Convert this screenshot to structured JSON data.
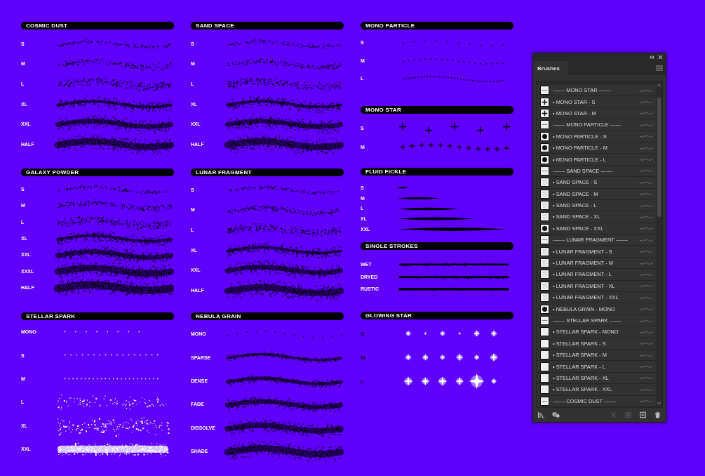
{
  "columns": [
    [
      {
        "title": "COSMIC DUST",
        "kind": "dust",
        "rows": [
          "S",
          "M",
          "L",
          "XL",
          "XXL",
          "HALF"
        ]
      },
      {
        "title": "GALAXY POWDER",
        "kind": "dust",
        "rows": [
          "S",
          "M",
          "L",
          "XL",
          "XXL",
          "XXXL",
          "HALF"
        ]
      },
      {
        "title": "STELLAR SPARK",
        "kind": "spark",
        "rows": [
          "MONO",
          "S",
          "M",
          "L",
          "XL",
          "XXL"
        ]
      }
    ],
    [
      {
        "title": "SAND SPACE",
        "kind": "dust",
        "rows": [
          "S",
          "M",
          "L",
          "XL",
          "XXL",
          "HALF"
        ]
      },
      {
        "title": "LUNAR FRAGMENT",
        "kind": "dust",
        "rows": [
          "S",
          "M",
          "L",
          "XL",
          "XXL",
          "HALF"
        ]
      },
      {
        "title": "NEBULA GRAIN",
        "kind": "grain",
        "rows": [
          "MONO",
          "SPARSE",
          "DENSE",
          "FADE",
          "DISSOLVE",
          "SHADE"
        ]
      }
    ],
    [
      {
        "title": "MONO PARTICLE",
        "kind": "particle",
        "rows": [
          "S",
          "M",
          "L"
        ]
      },
      {
        "title": "MONO STAR",
        "kind": "star",
        "rows": [
          "S",
          "M"
        ]
      },
      {
        "title": "FLUID FICKLE",
        "kind": "fickle",
        "rows": [
          "S",
          "M",
          "L",
          "XL",
          "XXL"
        ]
      },
      {
        "title": "SINGLE STROKES",
        "kind": "line",
        "rows": [
          "WET",
          "DRYED",
          "RUSTIC"
        ]
      },
      {
        "title": "GLOWING STAR",
        "kind": "glow",
        "rows": [
          "S",
          "M",
          "L"
        ]
      }
    ]
  ],
  "panel": {
    "tab": "Brushes",
    "items": [
      {
        "kind": "separator",
        "label": "------- MONO STAR -------"
      },
      {
        "kind": "plus",
        "label": "• MONO STAR - S"
      },
      {
        "kind": "plus",
        "label": "• MONO STAR - M"
      },
      {
        "kind": "separator",
        "label": "------- MONO PARTICLE ------"
      },
      {
        "kind": "dot",
        "label": "• MONO PARTICLE - S"
      },
      {
        "kind": "dot",
        "label": "• MONO PARTICLE - M"
      },
      {
        "kind": "dot",
        "label": "• MONO PARTICLE - L"
      },
      {
        "kind": "separator",
        "label": "------- SAND SPACE -------"
      },
      {
        "kind": "speckle",
        "label": "• SAND SPACE - S"
      },
      {
        "kind": "speckle",
        "label": "• SAND SPACE - M"
      },
      {
        "kind": "speckle",
        "label": "• SAND SPACE - L"
      },
      {
        "kind": "speckle",
        "label": "• SAND SPACE - XL"
      },
      {
        "kind": "dot",
        "label": "• SAND SPACE - XXL"
      },
      {
        "kind": "separator",
        "label": "------- LUNAR FRAGMENT -------"
      },
      {
        "kind": "speckle",
        "label": "• LUNAR FRAGMENT - S"
      },
      {
        "kind": "speckle",
        "label": "• LUNAR FRAGMENT - M"
      },
      {
        "kind": "speckle",
        "label": "• LUNAR FRAGMENT - L"
      },
      {
        "kind": "speckle",
        "label": "• LUNAR FRAGMENT - XL"
      },
      {
        "kind": "speckle",
        "label": "• LUNAR FRAGMENT - XXL"
      },
      {
        "kind": "dot",
        "label": "• NEBULA GRAIN - MONO"
      },
      {
        "kind": "separator",
        "label": "------- STELLAR SPARK -------"
      },
      {
        "kind": "blank",
        "label": "• STELLAR SPARK - MONO"
      },
      {
        "kind": "blank",
        "label": "• STELLAR SPARK - S"
      },
      {
        "kind": "blank",
        "label": "• STELLAR SPARK - M"
      },
      {
        "kind": "blank",
        "label": "• STELLAR SPARK - L"
      },
      {
        "kind": "blank",
        "label": "• STELLAR SPARK - XL"
      },
      {
        "kind": "blank",
        "label": "• STELLAR SPARK - XXL"
      },
      {
        "kind": "separator",
        "label": "------- COSMIC DUST -------"
      }
    ],
    "toolbar": [
      {
        "kind": "libraries",
        "disabled": false
      },
      {
        "kind": "stack",
        "disabled": false
      },
      {
        "kind": "remove",
        "disabled": true
      },
      {
        "kind": "options",
        "disabled": true
      },
      {
        "kind": "new",
        "disabled": false
      },
      {
        "kind": "trash",
        "disabled": false
      }
    ]
  }
}
